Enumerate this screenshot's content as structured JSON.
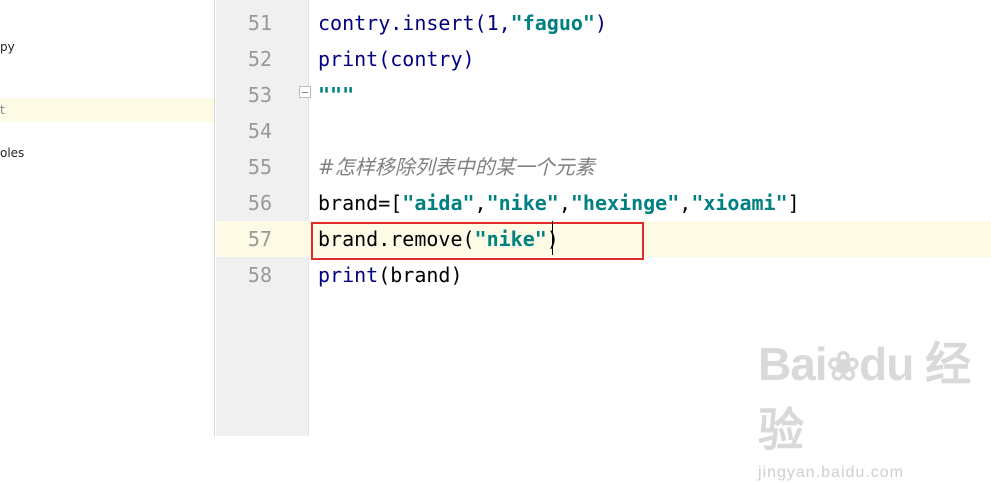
{
  "sidebar": {
    "items": [
      {
        "label": "py"
      },
      {
        "label": "t"
      },
      {
        "label": "oles"
      }
    ]
  },
  "editor": {
    "lines": [
      {
        "num": "51",
        "parts": [
          {
            "t": "contry.insert(1,",
            "c": "fn"
          },
          {
            "t": "\"faguo\"",
            "c": "str"
          },
          {
            "t": ")",
            "c": "fn"
          }
        ]
      },
      {
        "num": "52",
        "parts": [
          {
            "t": "print(contry)",
            "c": "fn"
          }
        ]
      },
      {
        "num": "53",
        "parts": [
          {
            "t": "\"\"\"",
            "c": "str"
          }
        ]
      },
      {
        "num": "54",
        "parts": []
      },
      {
        "num": "55",
        "parts": [
          {
            "t": "#怎样移除列表中的某一个元素",
            "c": "cmt"
          }
        ]
      },
      {
        "num": "56",
        "parts": [
          {
            "t": "brand=[",
            "c": ""
          },
          {
            "t": "\"aida\"",
            "c": "str"
          },
          {
            "t": ",",
            "c": ""
          },
          {
            "t": "\"nike\"",
            "c": "str"
          },
          {
            "t": ",",
            "c": ""
          },
          {
            "t": "\"hexinge\"",
            "c": "str"
          },
          {
            "t": ",",
            "c": ""
          },
          {
            "t": "\"xioami\"",
            "c": "str"
          },
          {
            "t": "]",
            "c": ""
          }
        ]
      },
      {
        "num": "57",
        "parts": [
          {
            "t": "brand.remove(",
            "c": ""
          },
          {
            "t": "\"nike\"",
            "c": "str"
          },
          {
            "t": ")",
            "c": ""
          }
        ]
      },
      {
        "num": "58",
        "parts": [
          {
            "t": "print",
            "c": "fn"
          },
          {
            "t": "(brand)",
            "c": ""
          }
        ]
      }
    ],
    "current_line_index": 6
  },
  "watermark": {
    "logo_text": "Bai",
    "logo_text2": "du",
    "logo_cn": "经验",
    "url": "jingyan.baidu.com"
  },
  "colors": {
    "string": "#008080",
    "keyword": "#000080",
    "comment": "#808080",
    "highlight": "#e32b2b",
    "current_line": "#fdfbe5"
  }
}
